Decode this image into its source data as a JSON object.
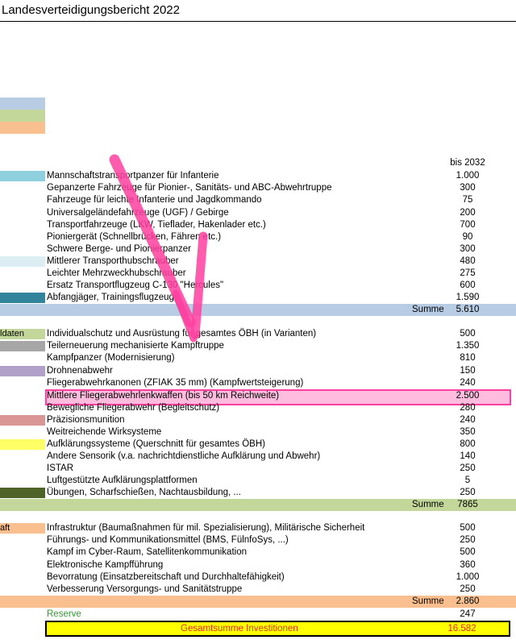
{
  "title": "Landesverteidigungsbericht 2022",
  "colors": {
    "highlight": "#ff3fa0",
    "total_fill": "#ffff00",
    "total_text": "#e0301e",
    "reserve_text": "#2e9b2e"
  },
  "column_header": "bis 2032",
  "section1": {
    "rows": [
      {
        "label": "Mannschaftstransportpanzer für Infanterie",
        "value": "1.000",
        "color": "#8fd0de"
      },
      {
        "label": "Gepanzerte Fahrzeuge für Pionier-, Sanitäts- und ABC-Abwehrtruppe",
        "value": "300",
        "color": ""
      },
      {
        "label": "Fahrzeuge für leichte Infanterie und Jagdkommando",
        "value": "75",
        "color": ""
      },
      {
        "label": "Universalgeländefahrzeuge (UGF) / Gebirge",
        "value": "200",
        "color": ""
      },
      {
        "label": "Transportfahrzeuge (LKW, Tieflader, Hakenlader etc.)",
        "value": "700",
        "color": ""
      },
      {
        "label": "Pioniergerät (Schnellbrücken, Fähren etc.)",
        "value": "90",
        "color": ""
      },
      {
        "label": "Schwere Berge- und Pionierpanzer",
        "value": "300",
        "color": ""
      },
      {
        "label": "Mittlerer Transporthubschrauber",
        "value": "480",
        "color": "#dceef3"
      },
      {
        "label": "Leichter Mehrzweckhubschrauber",
        "value": "275",
        "color": ""
      },
      {
        "label": "Ersatz Transportflugzeug C-130 \"Hercules\"",
        "value": "600",
        "color": ""
      },
      {
        "label": "Abfangjäger, Trainingsflugzeuge",
        "value": "1.590",
        "color": "#31849b"
      }
    ],
    "sum_label": "Summe",
    "sum_value": "5.610"
  },
  "section2": {
    "side_label": "ldaten",
    "rows": [
      {
        "label": "Individualschutz und Ausrüstung für gesamtes ÖBH (in Varianten)",
        "value": "500",
        "color": "#c4d79b"
      },
      {
        "label": "Teilerneuerung mechanisierte Kampftruppe",
        "value": "1.350",
        "color": "#a6a6a6"
      },
      {
        "label": "Kampfpanzer (Modernisierung)",
        "value": "810",
        "color": ""
      },
      {
        "label": "Drohnenabwehr",
        "value": "150",
        "color": "#b1a0c7"
      },
      {
        "label": "Fliegerabwehrkanonen (ZFIAK 35 mm) (Kampfwertsteigerung)",
        "value": "240",
        "color": ""
      },
      {
        "label": "Mittlere Fliegerabwehrlenkwaffen (bis 50 km Reichweite)",
        "value": "2.500",
        "color": ""
      },
      {
        "label": "Bewegliche Fliegerabwehr (Begleitschutz)",
        "value": "280",
        "color": ""
      },
      {
        "label": "Präzisionsmunition",
        "value": "240",
        "color": "#da9694"
      },
      {
        "label": "Weitreichende Wirksysteme",
        "value": "350",
        "color": ""
      },
      {
        "label": "Aufklärungssysteme (Querschnitt für gesamtes ÖBH)",
        "value": "800",
        "color": "#ffff66"
      },
      {
        "label": "Andere Sensorik (v.a. nachrichtdienstliche Aufklärung und Abwehr)",
        "value": "140",
        "color": ""
      },
      {
        "label": "ISTAR",
        "value": "250",
        "color": ""
      },
      {
        "label": "Luftgestützte Aufklärungsplattformen",
        "value": "5",
        "color": ""
      },
      {
        "label": "Übungen, Scharfschießen, Nachtausbildung, ...",
        "value": "250",
        "color": "#4f6228"
      }
    ],
    "sum_label": "Summe",
    "sum_value": "7865"
  },
  "section3": {
    "side_label": "aft",
    "rows": [
      {
        "label": "Infrastruktur (Baumaßnahmen für mil. Spezialisierung), Militärische Sicherheit",
        "value": "500",
        "color": "#fabf8f"
      },
      {
        "label": "Führungs- und Kommunikationsmittel (BMS, FülnfoSys, ...)",
        "value": "250",
        "color": ""
      },
      {
        "label": "Kampf im Cyber-Raum, Satellitenkommunikation",
        "value": "500",
        "color": ""
      },
      {
        "label": "Elektronische Kampfführung",
        "value": "360",
        "color": ""
      },
      {
        "label": "Bevorratung (Einsatzbereitschaft und Durchhaltefähigkeit)",
        "value": "1.000",
        "color": ""
      },
      {
        "label": "Verbesserung Versorgungs- und Sanitätstruppe",
        "value": "250",
        "color": ""
      }
    ],
    "sum_label": "Summe",
    "sum_value": "2.860"
  },
  "reserve": {
    "label": "Reserve",
    "value": "247"
  },
  "total": {
    "label": "Gesamtsumme Investitionen",
    "value": "16.582"
  }
}
